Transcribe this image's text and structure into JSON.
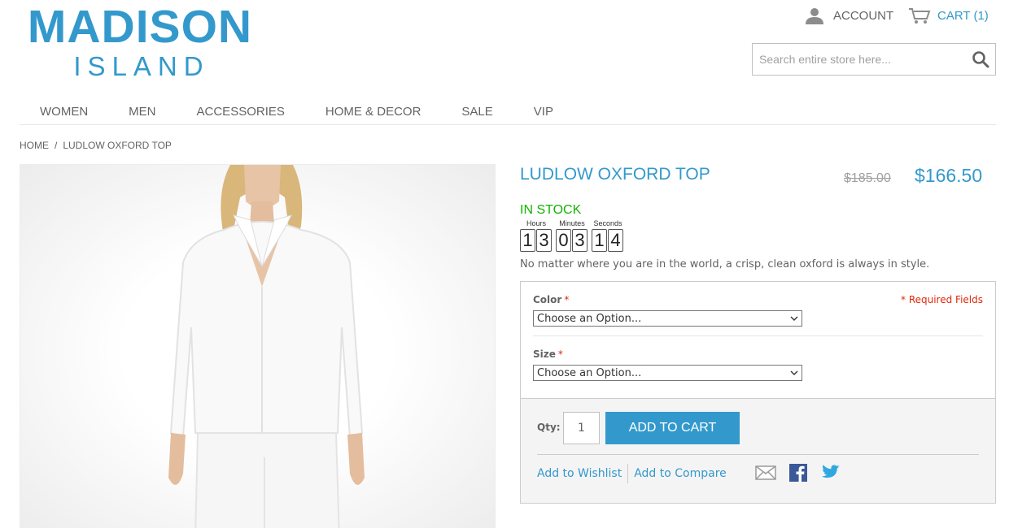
{
  "brand": {
    "line1": "MADISON",
    "line2": "ISLAND"
  },
  "header": {
    "account_label": "ACCOUNT",
    "cart_label": "CART (1)",
    "search_placeholder": "Search entire store here..."
  },
  "nav": {
    "items": [
      "WOMEN",
      "MEN",
      "ACCESSORIES",
      "HOME & DECOR",
      "SALE",
      "VIP"
    ]
  },
  "breadcrumb": {
    "home": "HOME",
    "separator": "/",
    "current": "LUDLOW OXFORD TOP"
  },
  "product": {
    "name": "LUDLOW OXFORD TOP",
    "old_price": "$185.00",
    "price": "$166.50",
    "availability": "IN STOCK",
    "description": "No matter where you are in the world, a crisp, clean oxford is always in style."
  },
  "countdown": {
    "hours_label": "Hours",
    "minutes_label": "Minutes",
    "seconds_label": "Seconds",
    "h1": "1",
    "h2": "3",
    "m1": "0",
    "m2": "3",
    "s1": "1",
    "s2": "4"
  },
  "options": {
    "required_note": "* Required Fields",
    "color_label": "Color",
    "size_label": "Size",
    "required_mark": "*",
    "color_value": "Choose an Option...",
    "size_value": "Choose an Option..."
  },
  "add_to_cart": {
    "qty_label": "Qty:",
    "qty_value": "1",
    "button_label": "ADD TO CART",
    "wishlist_label": "Add to Wishlist",
    "compare_label": "Add to Compare"
  },
  "colors": {
    "accent": "#3399cc",
    "in_stock": "#11b400",
    "required": "#df280a",
    "text": "#636363"
  },
  "icons": {
    "account": "user-icon",
    "cart": "cart-icon",
    "search": "search-icon",
    "email": "email-icon",
    "facebook": "facebook-icon",
    "twitter": "twitter-icon"
  }
}
